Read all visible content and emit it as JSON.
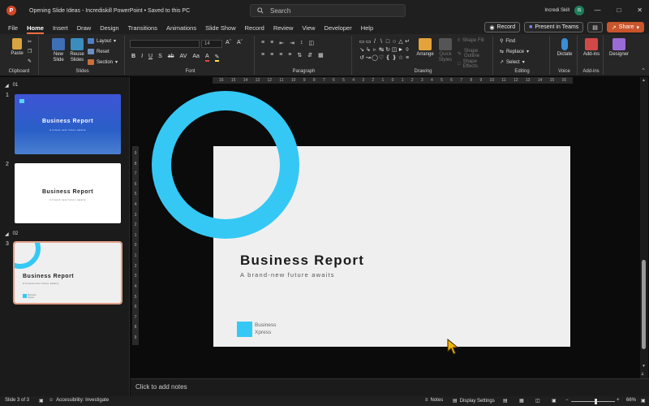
{
  "title_bar": {
    "doc_title": "Opening Slide Ideas - Incrediskill PowerPoint • Saved to this PC",
    "search_placeholder": "Search",
    "user_name": "Incredi Skill",
    "user_initials": "IS"
  },
  "menu": {
    "tabs": [
      "File",
      "Home",
      "Insert",
      "Draw",
      "Design",
      "Transitions",
      "Animations",
      "Slide Show",
      "Record",
      "Review",
      "View",
      "Developer",
      "Help"
    ],
    "active_tab": "Home",
    "record_label": "Record",
    "present_label": "Present in Teams",
    "share_label": "Share"
  },
  "ribbon": {
    "clipboard": {
      "label": "Clipboard",
      "paste": "Paste"
    },
    "slides": {
      "label": "Slides",
      "new_slide": "New Slide",
      "reuse_slides": "Reuse Slides",
      "layout": "Layout",
      "reset": "Reset",
      "section": "Section"
    },
    "font": {
      "label": "Font",
      "size": "14"
    },
    "paragraph": {
      "label": "Paragraph"
    },
    "drawing": {
      "label": "Drawing",
      "arrange": "Arrange",
      "quick_styles": "Quick Styles",
      "shape_fill": "Shape Fill",
      "shape_outline": "Shape Outline",
      "shape_effects": "Shape Effects"
    },
    "editing": {
      "label": "Editing",
      "find": "Find",
      "replace": "Replace",
      "select": "Select"
    },
    "voice": {
      "label": "Voice",
      "dictate": "Dictate"
    },
    "addins": {
      "label": "Add-ins",
      "addins": "Add-ins"
    },
    "designer": {
      "designer": "Designer"
    }
  },
  "thumbnails": {
    "sections": [
      {
        "num": "01"
      },
      {
        "num": "02"
      }
    ],
    "slides": [
      {
        "num": "1",
        "title": "Business Report",
        "sub": "A brand-new future awaits"
      },
      {
        "num": "2",
        "title": "Business Report",
        "sub": "A brand-new future awaits"
      },
      {
        "num": "3",
        "title": "Business Report",
        "sub": "A brand-new future awaits",
        "logo": "Business Xpress"
      }
    ]
  },
  "ruler_h": [
    "16",
    "15",
    "14",
    "13",
    "12",
    "11",
    "10",
    "9",
    "8",
    "7",
    "6",
    "5",
    "4",
    "3",
    "2",
    "1",
    "0",
    "1",
    "2",
    "3",
    "4",
    "5",
    "6",
    "7",
    "8",
    "9",
    "10",
    "11",
    "12",
    "13",
    "14",
    "15",
    "16"
  ],
  "ruler_v": [
    "9",
    "8",
    "7",
    "6",
    "5",
    "4",
    "3",
    "2",
    "1",
    "0",
    "1",
    "2",
    "3",
    "4",
    "5",
    "6",
    "7",
    "8",
    "9"
  ],
  "slide": {
    "title": "Business Report",
    "subtitle": "A brand-new future awaits",
    "logo_line1": "Business",
    "logo_line2": "Xpress"
  },
  "notes": {
    "placeholder": "Click to add notes"
  },
  "status": {
    "slide_info": "Slide 3 of 3",
    "accessibility": "Accessibility: Investigate",
    "notes": "Notes",
    "display_settings": "Display Settings",
    "zoom": "66%"
  },
  "colors": {
    "accent": "#35c8f4",
    "ppt_orange": "#c8552b",
    "slide_bg": "#efefef"
  }
}
